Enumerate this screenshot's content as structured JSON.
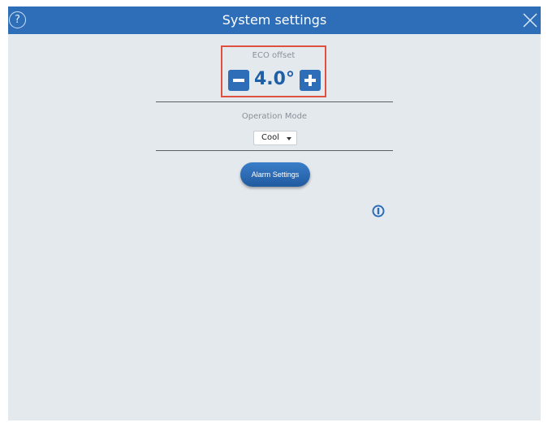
{
  "header": {
    "title": "System settings",
    "help_icon_glyph": "?",
    "accent_color": "#2e6db8"
  },
  "eco": {
    "label": "ECO offset",
    "value": "4.0°"
  },
  "operation": {
    "label": "Operation Mode",
    "selected": "Cool"
  },
  "alarm": {
    "label": "Alarm Settings"
  },
  "icons": [
    "help-icon",
    "close-icon",
    "minus-icon",
    "plus-icon",
    "info-icon",
    "dropdown-caret-icon"
  ]
}
